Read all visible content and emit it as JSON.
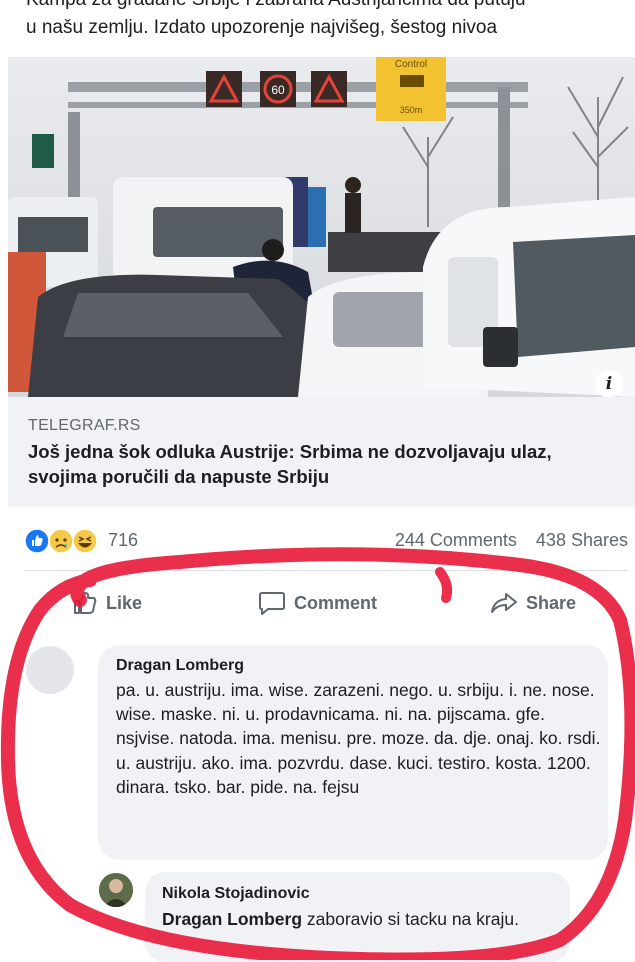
{
  "post": {
    "header_cut": "Kampa za građane Srbije i zabrana Austrijancima da putuju",
    "header_line": "u našu zemlju. Izdato upozorenje najvišeg, šestog nivoa"
  },
  "photo": {
    "sign_label": "Control",
    "sign_distance": "350m",
    "speed_sign": "60"
  },
  "link": {
    "source": "TELEGRAF.RS",
    "title": "Još jedna šok odluka Austrije: Srbima ne dozvoljavaju ulaz, svojima poručili da napuste Srbiju"
  },
  "engagement": {
    "reaction_icons": [
      "like-icon",
      "sad-icon",
      "haha-icon"
    ],
    "reaction_count": "716",
    "comments": "244 Comments",
    "shares": "438 Shares"
  },
  "actions": {
    "like": "Like",
    "comment": "Comment",
    "share": "Share"
  },
  "comment": {
    "author": "Dragan Lomberg",
    "text": "pa. u. austriju. ima. wise. zarazeni. nego. u. srbiju. i. ne. nose. wise. maske. ni. u. prodavnicama. ni. na. pijscama. gfe. nsjvise. natoda. ima.  menisu. pre. moze. da. dje. onaj. ko. rsdi. u. austriju. ako. ima. pozvrdu. dase. kuci. testiro. kosta. 1200. dinara. tsko. bar. pide. na. fejsu"
  },
  "reply": {
    "author": "Nikola Stojadinovic",
    "mention": "Dragan Lomberg",
    "text": " zaboravio si tacku na kraju."
  },
  "colors": {
    "accent_red": "#e8183a",
    "link_box": "#f0f2f5",
    "muted": "#606770"
  }
}
